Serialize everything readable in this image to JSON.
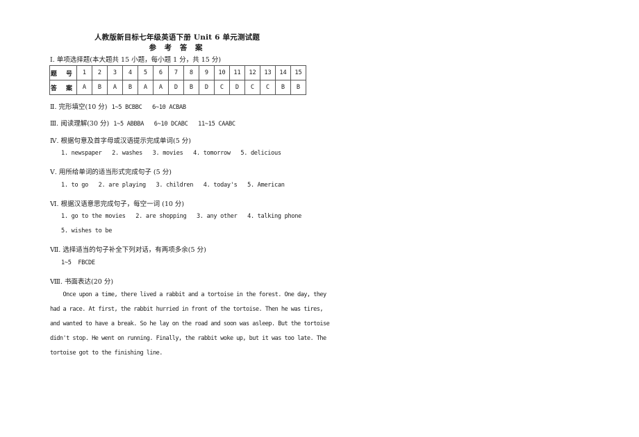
{
  "document": {
    "title": "人教版新目标七年级英语下册 Unit 6 单元测试题",
    "subtitle": "参 考 答 案"
  },
  "section1": {
    "heading": "Ⅰ. 单项选择题(本大题共 15 小题，每小题 1 分，共 15 分)",
    "table": {
      "row_header_number": "题 号",
      "row_header_answer": "答 案",
      "numbers": [
        "1",
        "2",
        "3",
        "4",
        "5",
        "6",
        "7",
        "8",
        "9",
        "10",
        "11",
        "12",
        "13",
        "14",
        "15"
      ],
      "answers": [
        "A",
        "B",
        "A",
        "B",
        "A",
        "A",
        "D",
        "B",
        "D",
        "C",
        "D",
        "C",
        "C",
        "B",
        "B"
      ]
    }
  },
  "section2": {
    "heading": "Ⅱ. 完形填空(10 分)",
    "answers": "1~5 BCBBC   6~10 ACBAB"
  },
  "section3": {
    "heading": "Ⅲ. 阅读理解(30 分)",
    "answers": "1~5 ABBBA   6~10 DCABC   11~15 CAABC"
  },
  "section4": {
    "heading": "Ⅳ. 根据句意及首字母或汉语提示完成单词(5 分)",
    "answers": "1. newspaper   2. washes   3. movies   4. tomorrow   5. delicious"
  },
  "section5": {
    "heading": "Ⅴ. 用所给单词的适当形式完成句子 (5 分)",
    "answers": "1. to go   2. are playing   3. children   4. today's   5. American"
  },
  "section6": {
    "heading": "Ⅵ. 根据汉语意思完成句子，每空一词 (10 分)",
    "answers_line1": "1. go to the movies   2. are shopping   3. any other   4. talking phone",
    "answers_line2": "5. wishes to be"
  },
  "section7": {
    "heading": "Ⅶ. 选择适当的句子补全下列对话，有两项多余(5 分)",
    "answers": "1~5  FBCDE"
  },
  "section8": {
    "heading": "Ⅷ. 书面表达(20 分)",
    "essay_lines": [
      "    Once upon a time, there lived a rabbit and a tortoise in the forest. One day, they",
      "had a race. At first, the rabbit hurried in front of the tortoise. Then he was tires,",
      "and wanted to have a break. So he lay on the road and soon was asleep. But the tortoise",
      "didn't stop. He went on running. Finally, the rabbit woke up, but it was too late. The",
      "tortoise got to the finishing line."
    ]
  }
}
